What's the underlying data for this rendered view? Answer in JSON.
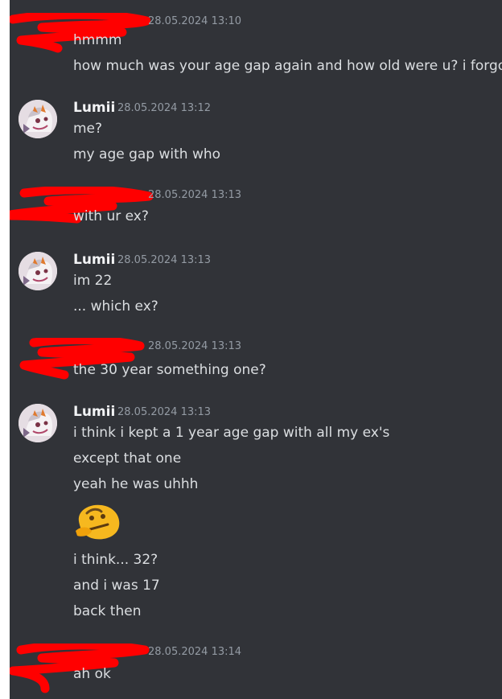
{
  "chat": {
    "messages": [
      {
        "author": "",
        "timestamp": "28.05.2024 13:10",
        "lines": [
          "hmmm",
          "how much was your age gap again and how old were u? i forgor"
        ]
      },
      {
        "author": "Lumii",
        "timestamp": "28.05.2024 13:12",
        "lines": [
          "me?",
          "my age gap with who"
        ]
      },
      {
        "author": "",
        "timestamp": "28.05.2024 13:13",
        "lines": [
          "with ur ex?"
        ]
      },
      {
        "author": "Lumii",
        "timestamp": "28.05.2024 13:13",
        "lines": [
          "im 22",
          "... which ex?"
        ]
      },
      {
        "author": "",
        "timestamp": "28.05.2024 13:13",
        "lines": [
          "the 30 year something one?"
        ]
      },
      {
        "author": "Lumii",
        "timestamp": "28.05.2024 13:13",
        "lines": [
          "i think i kept a 1 year age gap with all my ex's",
          "except that one",
          "yeah he was uhhh",
          "i think... 32?",
          "and i was 17",
          "back then"
        ],
        "emoji": "thinking-emoji"
      },
      {
        "author": "",
        "timestamp": "28.05.2024 13:14",
        "lines": [
          "ah ok"
        ]
      }
    ]
  },
  "colors": {
    "background": "#313338",
    "text": "#dbdee1",
    "name": "#f2f3f5",
    "timestamp": "#949ba4",
    "redaction": "#ff0000"
  }
}
